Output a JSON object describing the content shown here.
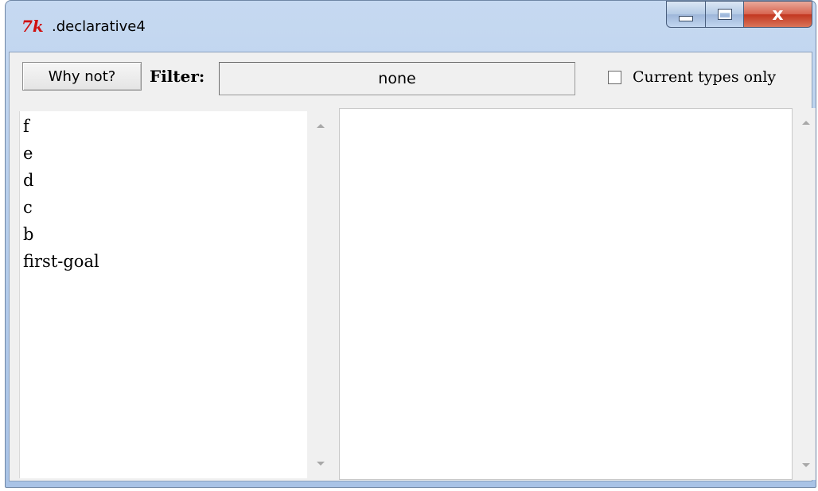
{
  "window": {
    "title": ".declarative4",
    "icon": "tk-icon",
    "icon_text": "7k",
    "close_glyph": "x"
  },
  "toolbar": {
    "why_not_label": "Why not?",
    "filter_label": "Filter:",
    "filter_value": "none",
    "current_types_label": "Current types only",
    "current_types_checked": false
  },
  "list": {
    "items": [
      "f",
      "e",
      "d",
      "c",
      "b",
      "first-goal"
    ]
  },
  "colors": {
    "titlebar": "#b8cfec",
    "client_bg": "#f0f0f0",
    "pane_bg": "#ffffff",
    "close_button": "#c2361f"
  }
}
